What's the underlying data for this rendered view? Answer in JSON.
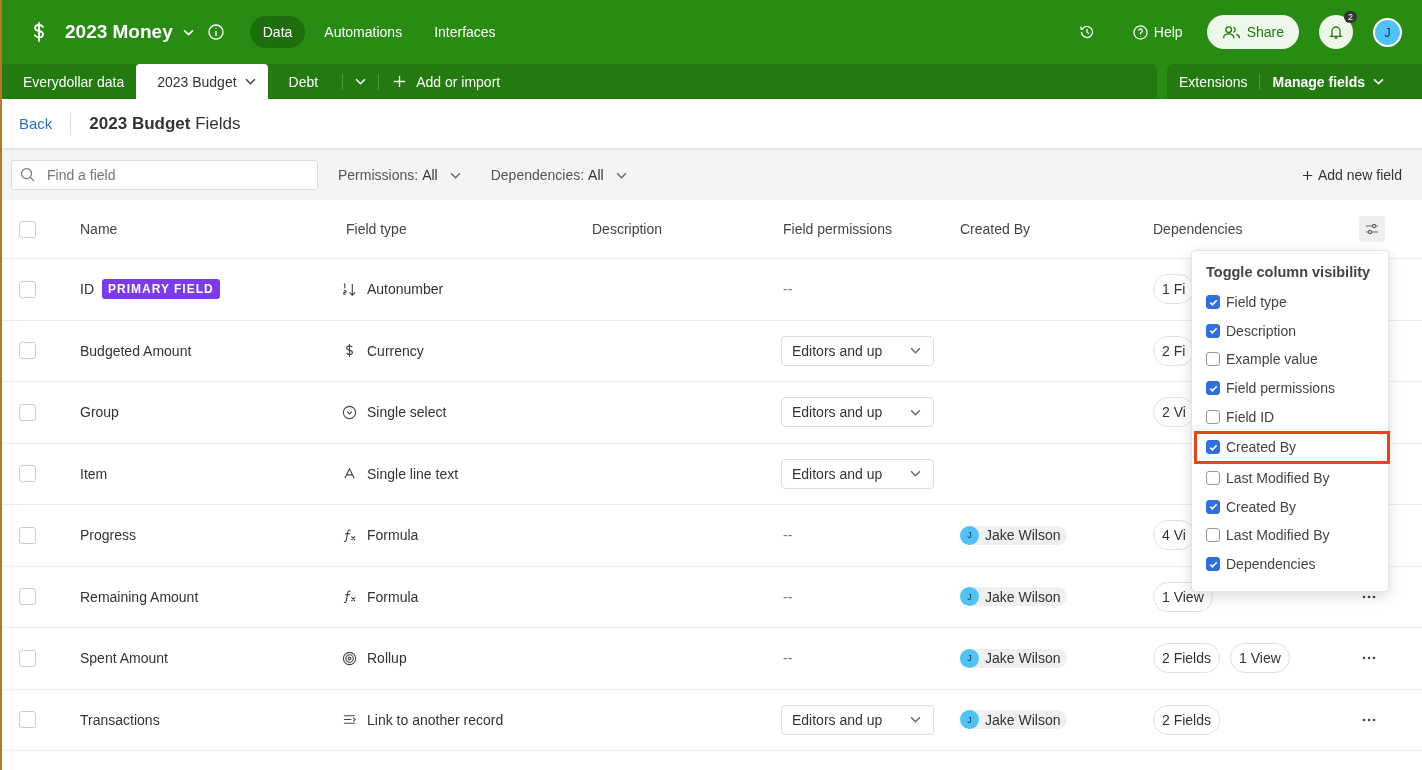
{
  "app": {
    "name": "2023 Money",
    "nav": [
      {
        "label": "Data",
        "selected": true
      },
      {
        "label": "Automations",
        "selected": false
      },
      {
        "label": "Interfaces",
        "selected": false
      }
    ],
    "help": "Help",
    "share": "Share",
    "notifications": "2",
    "avatar": "J"
  },
  "tables": {
    "tabs": [
      {
        "label": "Everydollar data",
        "selected": false,
        "caret": false
      },
      {
        "label": "2023 Budget",
        "selected": true,
        "caret": true
      },
      {
        "label": "Debt",
        "selected": false,
        "caret": false
      }
    ],
    "add": "Add or import",
    "extensions": "Extensions",
    "manage": "Manage fields"
  },
  "header": {
    "back": "Back",
    "title": "**2023 Budget** Fields"
  },
  "toolbar": {
    "search": {
      "placeholder": "Find a field"
    },
    "filters": [
      {
        "label": "Permissions:",
        "value": "All"
      },
      {
        "label": "Dependencies:",
        "value": "All"
      }
    ],
    "add": "Add new field"
  },
  "all_checked": false,
  "columns": [
    "Name",
    "Field type",
    "Description",
    "Field permissions",
    "Created By",
    "Dependencies"
  ],
  "rows": [
    {
      "checked": false,
      "name": "ID",
      "badge": "PRIMARY FIELD",
      "type": {
        "kind": "autonumber",
        "label": "Autonumber"
      },
      "permission": {
        "kind": "text",
        "value": "--"
      },
      "dependencies": [
        "1 Fi"
      ]
    },
    {
      "checked": false,
      "name": "Budgeted Amount",
      "type": {
        "kind": "currency",
        "label": "Currency"
      },
      "permission": {
        "kind": "select",
        "value": "Editors and up"
      },
      "dependencies": [
        "2 Fi"
      ]
    },
    {
      "checked": false,
      "name": "Group",
      "type": {
        "kind": "select",
        "label": "Single select"
      },
      "permission": {
        "kind": "select",
        "value": "Editors and up"
      },
      "dependencies": [
        "2 Vi"
      ]
    },
    {
      "checked": false,
      "name": "Item",
      "type": {
        "kind": "text",
        "label": "Single line text"
      },
      "permission": {
        "kind": "select",
        "value": "Editors and up"
      }
    },
    {
      "checked": false,
      "name": "Progress",
      "type": {
        "kind": "formula",
        "label": "Formula"
      },
      "permission": {
        "kind": "text",
        "value": "--"
      },
      "created_by": {
        "avatar": "J",
        "name": "Jake Wilson"
      },
      "dependencies": [
        "4 Vi"
      ]
    },
    {
      "checked": false,
      "name": "Remaining Amount",
      "type": {
        "kind": "formula",
        "label": "Formula"
      },
      "permission": {
        "kind": "text",
        "value": "--"
      },
      "created_by": {
        "avatar": "J",
        "name": "Jake Wilson"
      },
      "dependencies": [
        "1 View"
      ],
      "menu": true
    },
    {
      "checked": false,
      "name": "Spent Amount",
      "type": {
        "kind": "rollup",
        "label": "Rollup"
      },
      "permission": {
        "kind": "text",
        "value": "--"
      },
      "created_by": {
        "avatar": "J",
        "name": "Jake Wilson"
      },
      "dependencies": [
        "2 Fields",
        "1 View"
      ],
      "menu": true
    },
    {
      "checked": false,
      "name": "Transactions",
      "type": {
        "kind": "link",
        "label": "Link to another record"
      },
      "permission": {
        "kind": "select",
        "value": "Editors and up"
      },
      "created_by": {
        "avatar": "J",
        "name": "Jake Wilson"
      },
      "dependencies": [
        "2 Fields"
      ],
      "menu": true
    }
  ],
  "popup": {
    "title": "Toggle column visibility",
    "items": [
      {
        "label": "Field type",
        "checked": true
      },
      {
        "label": "Description",
        "checked": true
      },
      {
        "label": "Example value",
        "checked": false
      },
      {
        "label": "Field permissions",
        "checked": true
      },
      {
        "label": "Field ID",
        "checked": false
      },
      {
        "label": "Created By",
        "checked": true,
        "highlighted": true
      },
      {
        "label": "Last Modified By",
        "checked": false
      },
      {
        "label": "Created By",
        "checked": true
      },
      {
        "label": "Last Modified By",
        "checked": false
      },
      {
        "label": "Dependencies",
        "checked": true
      }
    ]
  }
}
